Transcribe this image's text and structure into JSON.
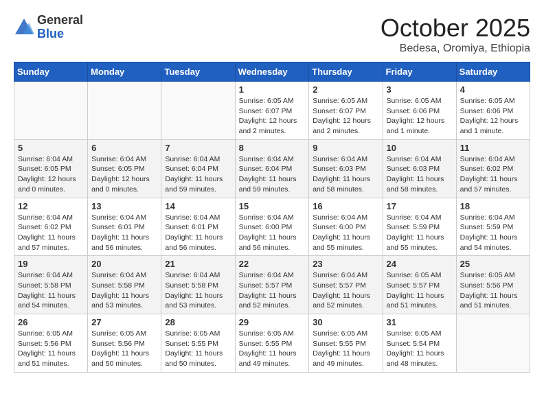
{
  "header": {
    "logo_general": "General",
    "logo_blue": "Blue",
    "month_title": "October 2025",
    "subtitle": "Bedesa, Oromiya, Ethiopia"
  },
  "weekdays": [
    "Sunday",
    "Monday",
    "Tuesday",
    "Wednesday",
    "Thursday",
    "Friday",
    "Saturday"
  ],
  "weeks": [
    [
      {
        "day": "",
        "info": ""
      },
      {
        "day": "",
        "info": ""
      },
      {
        "day": "",
        "info": ""
      },
      {
        "day": "1",
        "info": "Sunrise: 6:05 AM\nSunset: 6:07 PM\nDaylight: 12 hours and 2 minutes."
      },
      {
        "day": "2",
        "info": "Sunrise: 6:05 AM\nSunset: 6:07 PM\nDaylight: 12 hours and 2 minutes."
      },
      {
        "day": "3",
        "info": "Sunrise: 6:05 AM\nSunset: 6:06 PM\nDaylight: 12 hours and 1 minute."
      },
      {
        "day": "4",
        "info": "Sunrise: 6:05 AM\nSunset: 6:06 PM\nDaylight: 12 hours and 1 minute."
      }
    ],
    [
      {
        "day": "5",
        "info": "Sunrise: 6:04 AM\nSunset: 6:05 PM\nDaylight: 12 hours and 0 minutes."
      },
      {
        "day": "6",
        "info": "Sunrise: 6:04 AM\nSunset: 6:05 PM\nDaylight: 12 hours and 0 minutes."
      },
      {
        "day": "7",
        "info": "Sunrise: 6:04 AM\nSunset: 6:04 PM\nDaylight: 11 hours and 59 minutes."
      },
      {
        "day": "8",
        "info": "Sunrise: 6:04 AM\nSunset: 6:04 PM\nDaylight: 11 hours and 59 minutes."
      },
      {
        "day": "9",
        "info": "Sunrise: 6:04 AM\nSunset: 6:03 PM\nDaylight: 11 hours and 58 minutes."
      },
      {
        "day": "10",
        "info": "Sunrise: 6:04 AM\nSunset: 6:03 PM\nDaylight: 11 hours and 58 minutes."
      },
      {
        "day": "11",
        "info": "Sunrise: 6:04 AM\nSunset: 6:02 PM\nDaylight: 11 hours and 57 minutes."
      }
    ],
    [
      {
        "day": "12",
        "info": "Sunrise: 6:04 AM\nSunset: 6:02 PM\nDaylight: 11 hours and 57 minutes."
      },
      {
        "day": "13",
        "info": "Sunrise: 6:04 AM\nSunset: 6:01 PM\nDaylight: 11 hours and 56 minutes."
      },
      {
        "day": "14",
        "info": "Sunrise: 6:04 AM\nSunset: 6:01 PM\nDaylight: 11 hours and 56 minutes."
      },
      {
        "day": "15",
        "info": "Sunrise: 6:04 AM\nSunset: 6:00 PM\nDaylight: 11 hours and 56 minutes."
      },
      {
        "day": "16",
        "info": "Sunrise: 6:04 AM\nSunset: 6:00 PM\nDaylight: 11 hours and 55 minutes."
      },
      {
        "day": "17",
        "info": "Sunrise: 6:04 AM\nSunset: 5:59 PM\nDaylight: 11 hours and 55 minutes."
      },
      {
        "day": "18",
        "info": "Sunrise: 6:04 AM\nSunset: 5:59 PM\nDaylight: 11 hours and 54 minutes."
      }
    ],
    [
      {
        "day": "19",
        "info": "Sunrise: 6:04 AM\nSunset: 5:58 PM\nDaylight: 11 hours and 54 minutes."
      },
      {
        "day": "20",
        "info": "Sunrise: 6:04 AM\nSunset: 5:58 PM\nDaylight: 11 hours and 53 minutes."
      },
      {
        "day": "21",
        "info": "Sunrise: 6:04 AM\nSunset: 5:58 PM\nDaylight: 11 hours and 53 minutes."
      },
      {
        "day": "22",
        "info": "Sunrise: 6:04 AM\nSunset: 5:57 PM\nDaylight: 11 hours and 52 minutes."
      },
      {
        "day": "23",
        "info": "Sunrise: 6:04 AM\nSunset: 5:57 PM\nDaylight: 11 hours and 52 minutes."
      },
      {
        "day": "24",
        "info": "Sunrise: 6:05 AM\nSunset: 5:57 PM\nDaylight: 11 hours and 51 minutes."
      },
      {
        "day": "25",
        "info": "Sunrise: 6:05 AM\nSunset: 5:56 PM\nDaylight: 11 hours and 51 minutes."
      }
    ],
    [
      {
        "day": "26",
        "info": "Sunrise: 6:05 AM\nSunset: 5:56 PM\nDaylight: 11 hours and 51 minutes."
      },
      {
        "day": "27",
        "info": "Sunrise: 6:05 AM\nSunset: 5:56 PM\nDaylight: 11 hours and 50 minutes."
      },
      {
        "day": "28",
        "info": "Sunrise: 6:05 AM\nSunset: 5:55 PM\nDaylight: 11 hours and 50 minutes."
      },
      {
        "day": "29",
        "info": "Sunrise: 6:05 AM\nSunset: 5:55 PM\nDaylight: 11 hours and 49 minutes."
      },
      {
        "day": "30",
        "info": "Sunrise: 6:05 AM\nSunset: 5:55 PM\nDaylight: 11 hours and 49 minutes."
      },
      {
        "day": "31",
        "info": "Sunrise: 6:05 AM\nSunset: 5:54 PM\nDaylight: 11 hours and 48 minutes."
      },
      {
        "day": "",
        "info": ""
      }
    ]
  ]
}
